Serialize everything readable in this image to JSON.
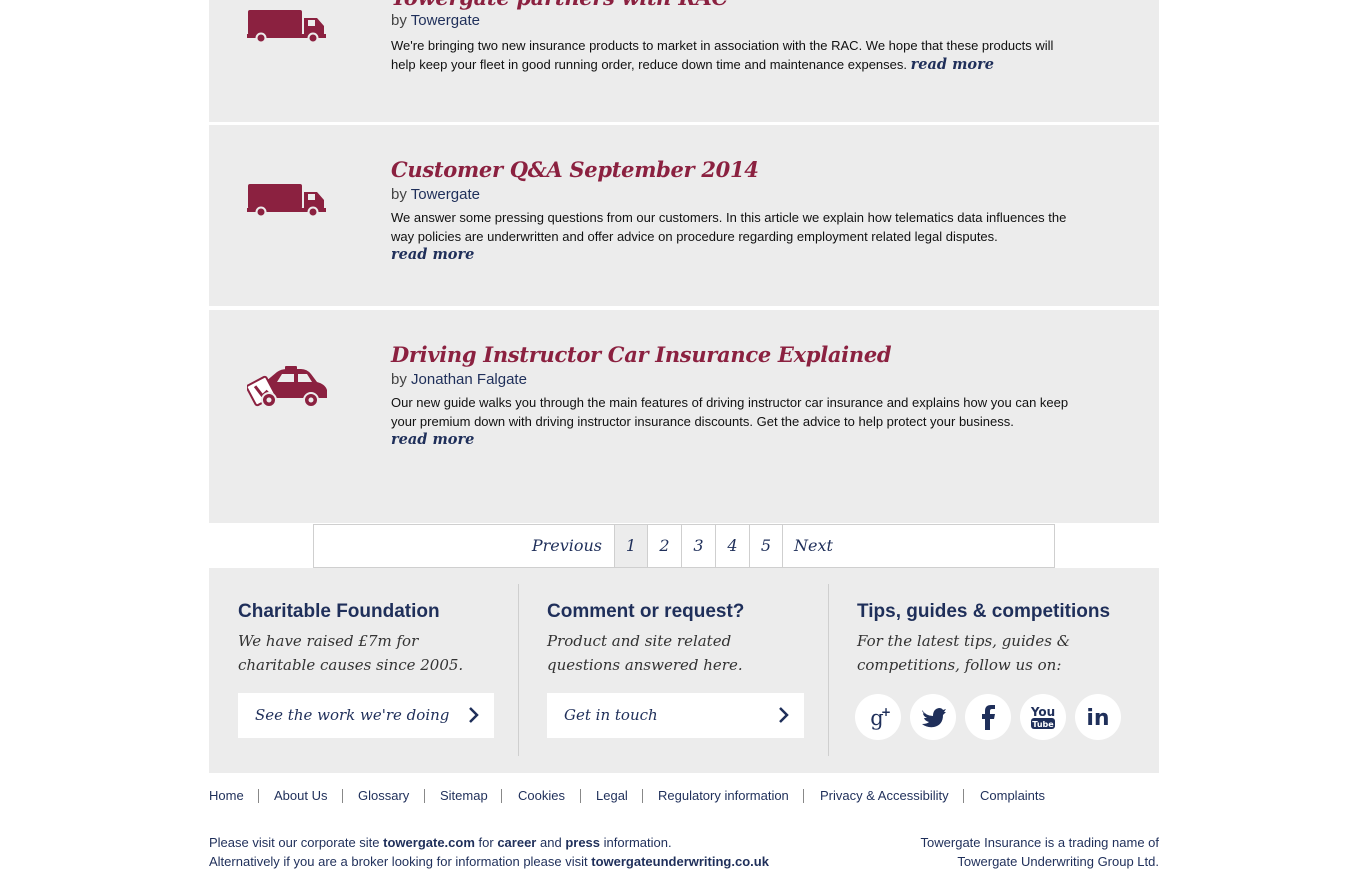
{
  "articles": [
    {
      "title": "Towergate partners with RAC",
      "by": "by",
      "author": "Towergate",
      "description": "We're bringing two new insurance products to market in association with the RAC. We hope that these products will help keep your fleet in good running order, reduce down time and maintenance expenses.",
      "read_more": "read more",
      "icon": "truck-icon"
    },
    {
      "title": "Customer Q&A September 2014",
      "by": "by",
      "author": "Towergate",
      "description": "We answer some pressing questions from our customers. In this article we explain how telematics data influences the way policies are underwritten and offer advice on procedure regarding employment related legal disputes.",
      "read_more": "read more",
      "icon": "truck-icon"
    },
    {
      "title": "Driving Instructor Car Insurance Explained",
      "by": "by",
      "author": "Jonathan Falgate",
      "description": "Our new guide walks you through the main features of driving instructor car insurance and explains how you can keep your premium down with driving instructor insurance discounts. Get the advice to help protect your business.",
      "read_more": "read more",
      "icon": "learner-car-icon"
    }
  ],
  "pagination": {
    "previous": "Previous",
    "pages": [
      "1",
      "2",
      "3",
      "4",
      "5"
    ],
    "current": "1",
    "next": "Next"
  },
  "footer": {
    "charity": {
      "heading": "Charitable Foundation",
      "text": "We have raised £7m for charitable causes since 2005.",
      "button": "See the work we're doing"
    },
    "comment": {
      "heading": "Comment or request?",
      "text": "Product and site related questions answered here.",
      "button": "Get in touch"
    },
    "tips": {
      "heading": "Tips, guides & competitions",
      "text": "For the latest tips, guides & competitions, follow us on:",
      "social": [
        "google-plus-icon",
        "twitter-icon",
        "facebook-icon",
        "youtube-icon",
        "linkedin-icon"
      ]
    }
  },
  "footer_nav": [
    "Home",
    "About Us",
    "Glossary",
    "Sitemap",
    "Cookies",
    "Legal",
    "Regulatory information",
    "Privacy & Accessibility",
    "Complaints"
  ],
  "bottom": {
    "line1_a": "Please visit our corporate site",
    "line1_link": "towergate.com",
    "line1_b": "for",
    "line1_career": "career",
    "line1_and": "and",
    "line1_press": "press",
    "line1_c": "information.",
    "line2_a": "Alternatively if you are a broker looking for information please visit",
    "line2_link": "towergateunderwriting.co.uk",
    "right_line1": "Towergate Insurance is a trading name of",
    "right_line2": "Towergate Underwriting Group Ltd."
  },
  "colors": {
    "brand_red": "#8b2140",
    "navy": "#1f2f5a",
    "panel_grey": "#ececec"
  }
}
